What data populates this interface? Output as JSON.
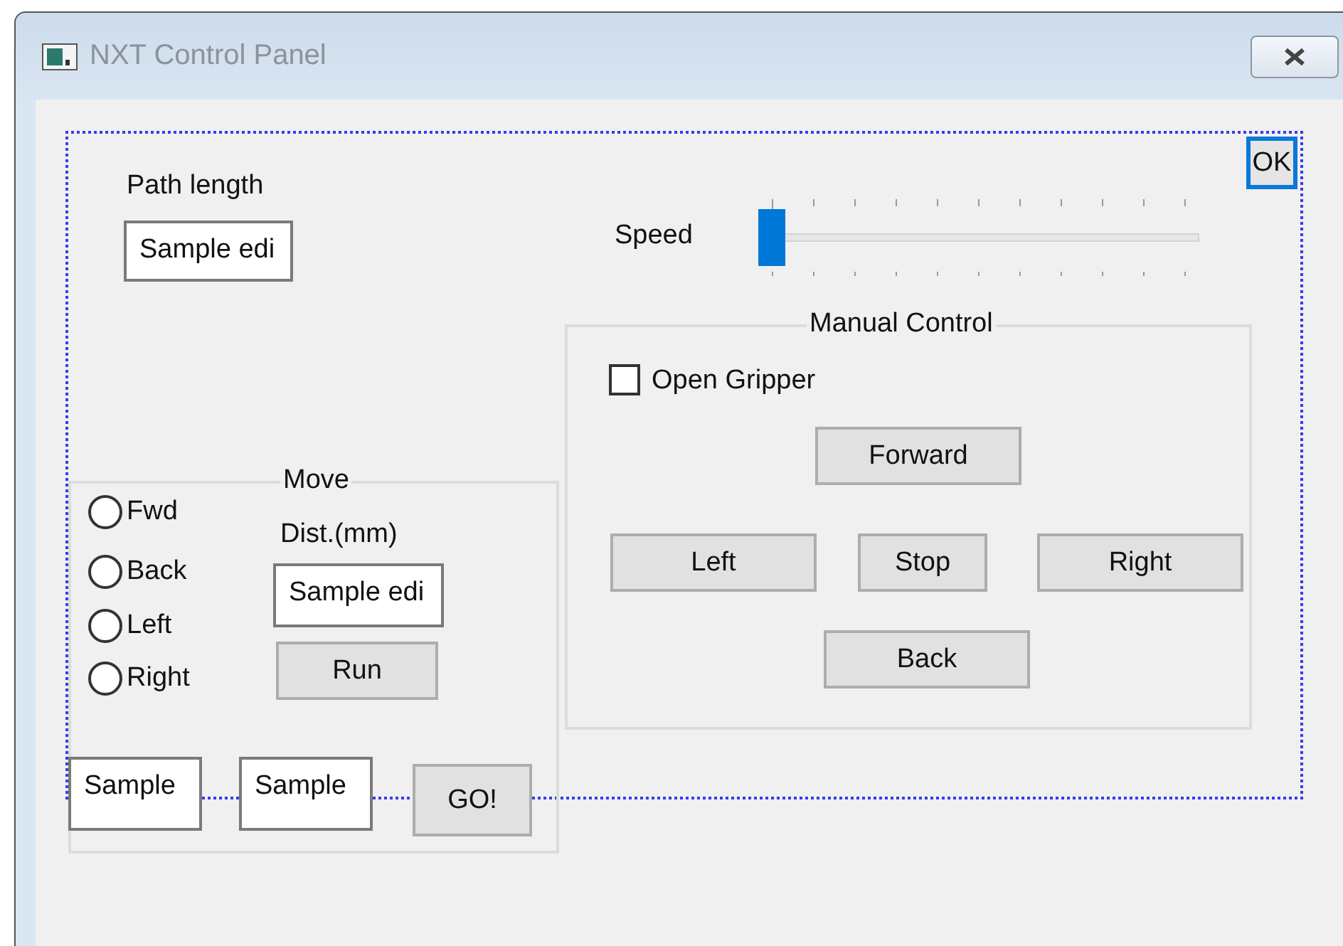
{
  "window": {
    "title": "NXT Control Panel"
  },
  "ok_button": "OK",
  "path_length": {
    "label": "Path length",
    "value": "Sample edi"
  },
  "speed": {
    "label": "Speed",
    "level": 0
  },
  "manual_control": {
    "title": "Manual Control",
    "checkbox": {
      "label": "Open Gripper",
      "checked": false
    },
    "buttons": [
      {
        "label": "Forward"
      },
      {
        "label": "Left"
      },
      {
        "label": "Stop"
      },
      {
        "label": "Right"
      },
      {
        "label": "Back"
      }
    ]
  },
  "move": {
    "title": "Move",
    "radios": [
      {
        "label": "Fwd",
        "selected": false
      },
      {
        "label": "Back",
        "selected": false
      },
      {
        "label": "Left",
        "selected": false
      },
      {
        "label": "Right",
        "selected": false
      }
    ],
    "distance_label": "Dist.(mm)",
    "distance_value": "Sample edi",
    "run_button": "Run"
  },
  "bottom_fields": [
    "Sample",
    "Sample"
  ],
  "go_button": "GO!"
}
